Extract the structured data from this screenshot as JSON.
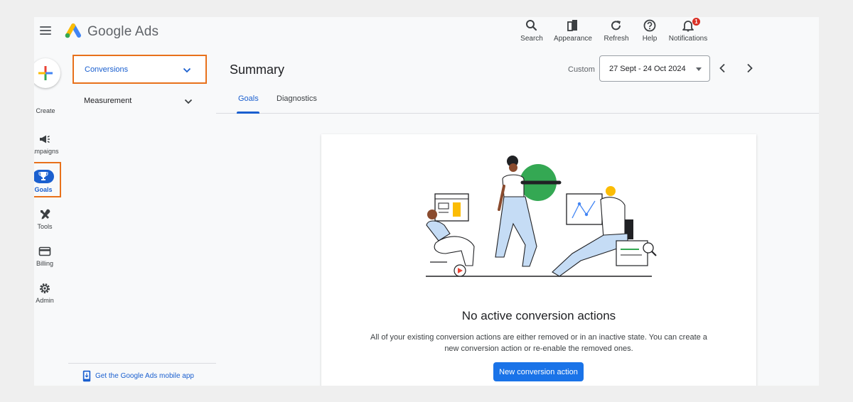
{
  "app": {
    "brand": "Google Ads"
  },
  "topbar": {
    "search": "Search",
    "appearance": "Appearance",
    "refresh": "Refresh",
    "help": "Help",
    "notifications": "Notifications",
    "notification_count": "1"
  },
  "rail": {
    "create": "Create",
    "campaigns": "ampaigns",
    "goals": "Goals",
    "tools": "Tools",
    "billing": "Billing",
    "admin": "Admin"
  },
  "sidenav": {
    "conversions": "Conversions",
    "measurement": "Measurement",
    "mobile_app": "Get the Google Ads mobile app"
  },
  "main": {
    "title": "Summary",
    "date_label": "Custom",
    "date_range": "27 Sept - 24 Oct 2024",
    "tabs": [
      {
        "label": "Goals",
        "active": true
      },
      {
        "label": "Diagnostics",
        "active": false
      }
    ]
  },
  "empty_state": {
    "title": "No active conversion actions",
    "description": "All of your existing conversion actions are either removed or in an inactive state. You can create a new conversion action or re-enable the removed ones.",
    "button": "New conversion action"
  },
  "colors": {
    "accent": "#1a73e8",
    "highlight": "#e8711b",
    "nav_active": "#1a5fcf"
  }
}
